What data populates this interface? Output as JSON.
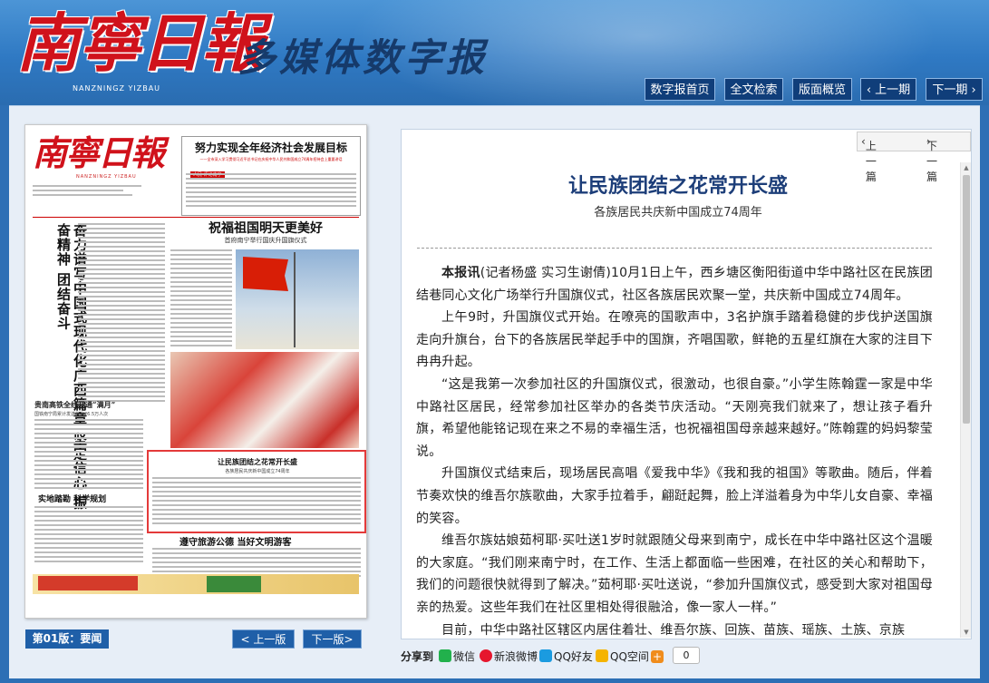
{
  "header": {
    "logo": "南寧日報",
    "logo_pinyin": "NANZNINGZ YIZBAU",
    "subtitle": "多媒体数字报",
    "nav": [
      "数字报首页",
      "全文检索",
      "版面概览",
      "上一期",
      "下一期"
    ]
  },
  "newspaper": {
    "masthead_logo": "南寧日報",
    "masthead_pinyin": "NANZNINGZ YIZBAU",
    "top_headline": "努力实现全年经济社会发展目标",
    "top_subline": "——全市深入学习贯彻习近平总书记在庆祝中华人民共和国成立74周年招待会上重要讲话",
    "top_tag": "人民·评论南宁",
    "vertical_headline": "奋力谱写中国式现代化广西篇章 坚定信心 振奋精神 团结奋斗",
    "main_headline": "祝福祖国明天更美好",
    "main_subline": "首府南宁举行国庆升国旗仪式",
    "left_headline": "贵南高铁全线开通“满月”",
    "left_subline": "国铁南宁局累计发送旅客26.5万人次",
    "highlight_title": "让民族团结之花常开长盛",
    "highlight_subtitle": "各族居民共庆新中国成立74周年",
    "left_bottom_headline": "实地踏勘 科学规划",
    "bottom_headline": "遵守旅游公德 当好文明游客"
  },
  "edition": {
    "label": "第01版：要闻",
    "prev": "上一版",
    "next": "下一版"
  },
  "article": {
    "nav_prev": "上一篇",
    "nav_next": "下一篇",
    "title": "让民族团结之花常开长盛",
    "subtitle": "各族居民共庆新中国成立74周年",
    "lead_label": "本报讯",
    "paragraphs": [
      "(记者杨盛 实习生谢倩)10月1日上午，西乡塘区衡阳街道中华中路社区在民族团结巷同心文化广场举行升国旗仪式，社区各族居民欢聚一堂，共庆新中国成立74周年。",
      "上午9时，升国旗仪式开始。在嘹亮的国歌声中，3名护旗手踏着稳健的步伐护送国旗走向升旗台，台下的各族居民举起手中的国旗，齐唱国歌，鲜艳的五星红旗在大家的注目下冉冉升起。",
      "“这是我第一次参加社区的升国旗仪式，很激动，也很自豪。”小学生陈翰霆一家是中华中路社区居民，经常参加社区举办的各类节庆活动。“天刚亮我们就来了，想让孩子看升旗，希望他能铭记现在来之不易的幸福生活，也祝福祖国母亲越来越好。”陈翰霆的妈妈黎莹说。",
      "升国旗仪式结束后，现场居民高唱《爱我中华》《我和我的祖国》等歌曲。随后，伴着节奏欢快的维吾尔族歌曲，大家手拉着手，翩跹起舞，脸上洋溢着身为中华儿女自豪、幸福的笑容。",
      "维吾尔族姑娘茹柯耶·买吐送1岁时就跟随父母来到南宁，成长在中华中路社区这个温暖的大家庭。“我们刚来南宁时，在工作、生活上都面临一些困难，在社区的关心和帮助下，我们的问题很快就得到了解决。”茹柯耶·买吐送说，“参加升国旗仪式，感受到大家对祖国母亲的热爱。这些年我们在社区里相处得很融洽，像一家人一样。”",
      "目前，中华中路社区辖区内居住着壮、维吾尔族、回族、苗族、瑶族、土族、京族"
    ]
  },
  "share": {
    "label": "分享到",
    "items": [
      {
        "name": "微信",
        "icon": "wechat-icon",
        "color": "#22b14c"
      },
      {
        "name": "新浪微博",
        "icon": "weibo-icon",
        "color": "#e6162d"
      },
      {
        "name": "QQ好友",
        "icon": "qq-icon",
        "color": "#1b9be0"
      },
      {
        "name": "QQ空间",
        "icon": "qzone-icon",
        "color": "#f5b400"
      }
    ],
    "more_icon": "plus-icon",
    "count": "0"
  },
  "colors": {
    "header_blue": "#2f79c3",
    "nav_button": "#103e7a",
    "title_blue": "#1d3e79",
    "highlight_red": "#e43a3a"
  }
}
